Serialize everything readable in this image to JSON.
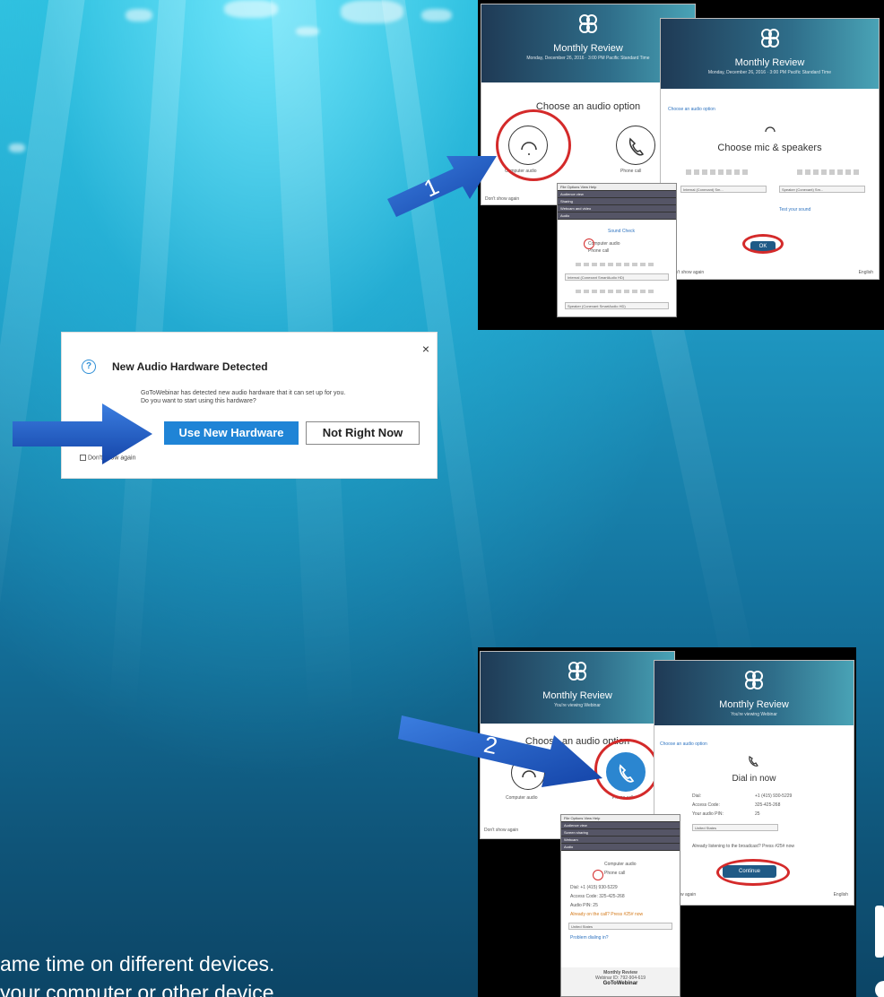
{
  "top_panel": {
    "back_window": {
      "title": "Monthly Review",
      "subtitle": "Monday, December 26, 2016 · 3:00 PM Pacific Standard Time",
      "caption": "Choose an audio option",
      "option_1": "Computer audio",
      "option_2": "Phone call",
      "dont_show": "Don't show again"
    },
    "front_window": {
      "title": "Monthly Review",
      "subtitle": "Monday, December 26, 2016 · 3:00 PM Pacific Standard Time",
      "back_link": "Choose an audio option",
      "heading": "Choose mic & speakers",
      "mic_select": "Internal (Conexant) Sm...",
      "speaker_select": "Speaker (Conexant) Sm...",
      "test_link": "Test your sound",
      "ok_button": "OK",
      "footer_left": "Don't show again",
      "footer_right": "English"
    },
    "control_panel": {
      "menu": "File  Options  View  Help",
      "rows": [
        "Audience view",
        "Sharing",
        "Webcam and video",
        "Audio"
      ],
      "sound_check": "Sound Check",
      "radio_1": "Computer audio",
      "radio_2": "Phone call",
      "mic_select": "Internal (Conexant SmartAudio HD)",
      "speaker_select": "Speaker (Conexant SmartAudio HD)"
    },
    "step_number": "1"
  },
  "dialog": {
    "title": "New Audio Hardware Detected",
    "body_1": "GoToWebinar has detected new audio hardware that it can set up for you.",
    "body_2": "Do you want to start using this hardware?",
    "primary_button": "Use New Hardware",
    "secondary_button": "Not Right Now",
    "checkbox_label": "Don't show again",
    "close": "×"
  },
  "bottom_panel": {
    "back_window": {
      "title": "Monthly Review",
      "subtitle": "You're viewing Webinar",
      "caption": "Choose an audio option",
      "option_1": "Computer audio",
      "option_2": "Phone call",
      "dont_show": "Don't show again"
    },
    "front_window": {
      "title": "Monthly Review",
      "subtitle": "You're viewing Webinar",
      "back_link": "Choose an audio option",
      "heading": "Dial in now",
      "dial_label": "Dial:",
      "dial_value": "+1 (415) 930-5229",
      "access_label": "Access Code:",
      "access_value": "325-425-268",
      "pin_label": "Your audio PIN:",
      "pin_value": "25",
      "country": "United States",
      "already_link": "Already listening to the broadcast? Press #25# now",
      "continue_button": "Continue",
      "footer_left": "Don't show again",
      "footer_right": "English"
    },
    "control_panel": {
      "menu": "File  Options  View  Help",
      "rows": [
        "Audience view",
        "Screen sharing",
        "Webcam",
        "Audio"
      ],
      "radio_1": "Computer audio",
      "radio_2": "Phone call",
      "dial": "Dial:  +1 (415) 930-5229",
      "access": "Access Code:  325-425-268",
      "pin": "Audio PIN:  25",
      "already": "Already on the call? Press #25# now",
      "country": "United States",
      "problem_link": "Problem dialing in?",
      "footer_title": "Monthly Review",
      "footer_id": "Webinar ID: 792-904-619",
      "brand": "GoToWebinar"
    },
    "step_number": "2"
  },
  "bottom_text": {
    "line_1": "ame time on different devices.",
    "line_2": " your computer or other device"
  },
  "colors": {
    "accent_red": "#d42a2a",
    "primary_blue": "#1f84d6",
    "arrow_blue": "#1f5fc8"
  }
}
